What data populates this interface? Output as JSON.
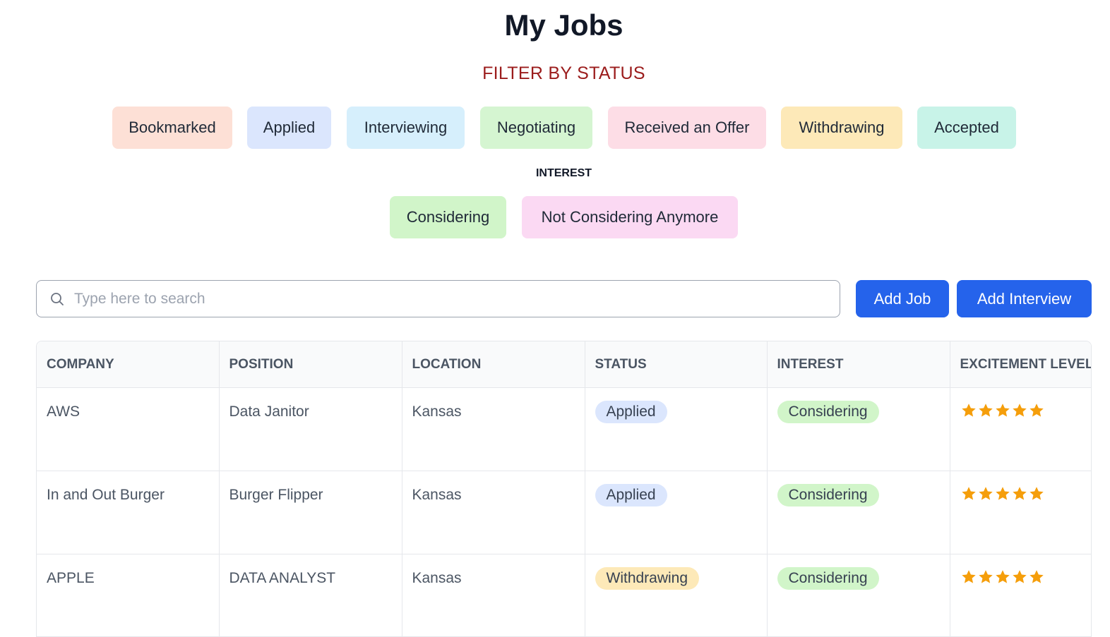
{
  "page": {
    "title": "My Jobs"
  },
  "filters": {
    "heading": "FILTER BY STATUS",
    "status_chips": [
      {
        "label": "Bookmarked",
        "bg": "#fde0d6"
      },
      {
        "label": "Applied",
        "bg": "#dbe6fd"
      },
      {
        "label": "Interviewing",
        "bg": "#d6effc"
      },
      {
        "label": "Negotiating",
        "bg": "#d5f5d1"
      },
      {
        "label": "Received an Offer",
        "bg": "#fddde6"
      },
      {
        "label": "Withdrawing",
        "bg": "#fde9b8"
      },
      {
        "label": "Accepted",
        "bg": "#c8f3e8"
      }
    ],
    "interest_heading": "INTEREST",
    "interest_chips": [
      {
        "label": "Considering",
        "bg": "#d1f5c9"
      },
      {
        "label": "Not Considering Anymore",
        "bg": "#fbd9f3"
      }
    ]
  },
  "search": {
    "placeholder": "Type here to search",
    "value": "",
    "icon": "search-icon"
  },
  "actions": {
    "add_job": "Add Job",
    "add_interview": "Add Interview",
    "color": "#2563eb"
  },
  "table": {
    "columns": [
      "COMPANY",
      "POSITION",
      "LOCATION",
      "STATUS",
      "INTEREST",
      "EXCITEMENT LEVEL"
    ],
    "rows": [
      {
        "company": "AWS",
        "position": "Data Janitor",
        "location": "Kansas",
        "status": "Applied",
        "interest": "Considering",
        "excitement": 5
      },
      {
        "company": "In and Out Burger",
        "position": "Burger Flipper",
        "location": "Kansas",
        "status": "Applied",
        "interest": "Considering",
        "excitement": 5
      },
      {
        "company": "APPLE",
        "position": "DATA ANALYST",
        "location": "Kansas",
        "status": "Withdrawing",
        "interest": "Considering",
        "excitement": 5
      }
    ],
    "status_colors": {
      "Applied": "#dbe6fd",
      "Withdrawing": "#fde9b8"
    },
    "interest_colors": {
      "Considering": "#d1f5c9"
    },
    "star_color": "#f59e0b"
  }
}
